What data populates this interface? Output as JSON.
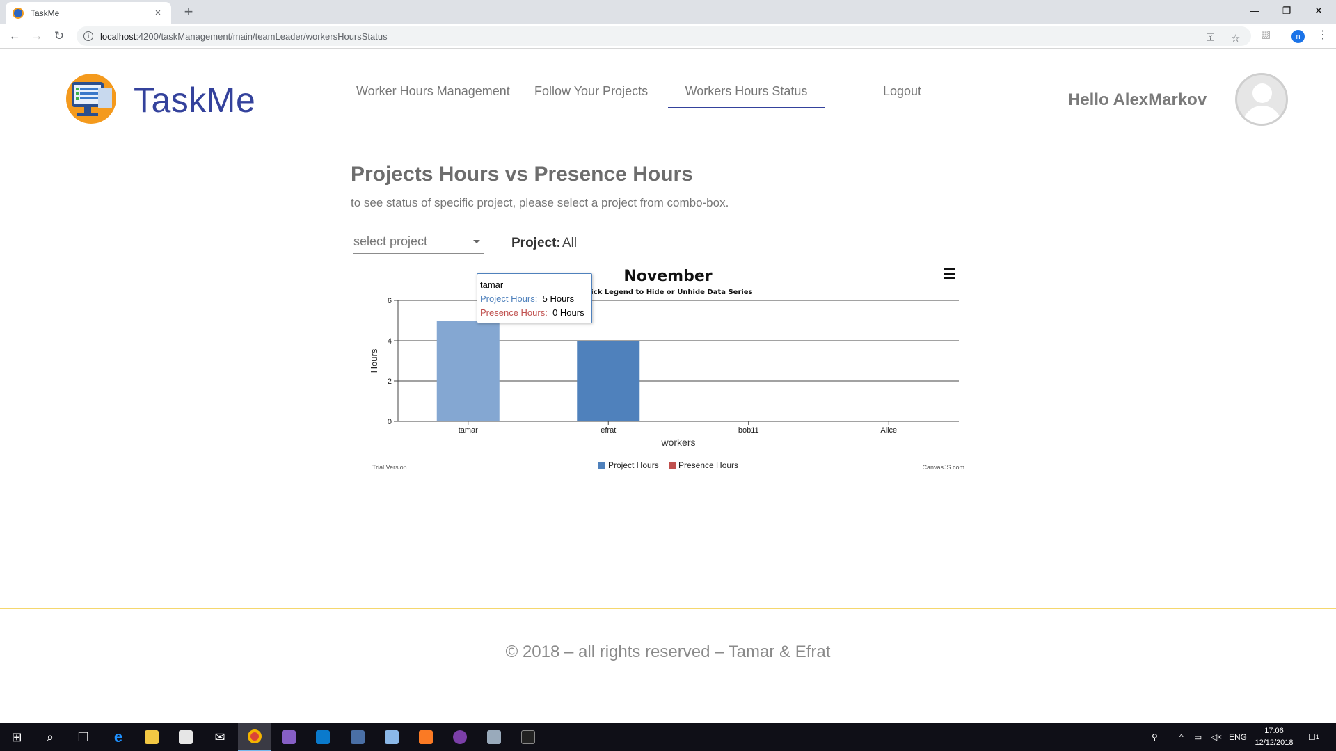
{
  "browser": {
    "tab_title": "TaskMe",
    "tab_close": "×",
    "new_tab": "+",
    "url_host": "localhost",
    "url_path": ":4200/taskManagement/main/teamLeader/workersHoursStatus",
    "profile_initial": "n",
    "window_controls": {
      "minimize": "—",
      "restore": "❐",
      "close": "✕"
    }
  },
  "header": {
    "brand": "TaskMe",
    "nav": [
      {
        "label": "Worker Hours Management",
        "active": false
      },
      {
        "label": "Follow Your Projects",
        "active": false
      },
      {
        "label": "Workers Hours Status",
        "active": true
      },
      {
        "label": "Logout",
        "active": false
      }
    ],
    "greeting": "Hello AlexMarkov"
  },
  "main": {
    "title": "Projects Hours vs Presence Hours",
    "subtitle": "to see status of specific project, please select a project from combo-box.",
    "select_placeholder": "select project",
    "project_label": "Project:",
    "project_value": "All"
  },
  "chart_data": {
    "type": "bar",
    "title": "November",
    "subtitle": "Click Legend to Hide or Unhide Data Series",
    "xlabel": "workers",
    "ylabel": "Hours",
    "categories": [
      "tamar",
      "efrat",
      "bob11",
      "Alice"
    ],
    "series": [
      {
        "name": "Project Hours",
        "values": [
          5,
          4,
          0,
          0
        ],
        "color": "#4f81bc"
      },
      {
        "name": "Presence Hours",
        "values": [
          0,
          0,
          0,
          0
        ],
        "color": "#c0504e"
      }
    ],
    "ylim": [
      0,
      6
    ],
    "yticks": [
      0,
      2,
      4,
      6
    ],
    "grid": true,
    "legend_position": "bottom",
    "highlighted_category": "tamar",
    "trial_text": "Trial Version",
    "credit_text": "CanvasJS.com",
    "tooltip": {
      "name": "tamar",
      "rows": [
        {
          "label": "Project Hours:",
          "value": "5 Hours"
        },
        {
          "label": "Presence Hours:",
          "value": "0 Hours"
        }
      ]
    }
  },
  "footer": {
    "text": "© 2018 – all rights reserved – Tamar & Efrat"
  },
  "taskbar": {
    "language": "ENG",
    "time": "17:06",
    "date": "12/12/2018",
    "notification_count": "1"
  }
}
